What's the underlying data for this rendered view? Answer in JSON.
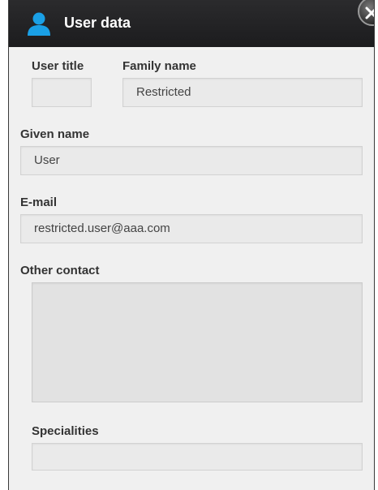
{
  "dialog": {
    "title": "User data",
    "close_icon": "close-icon",
    "title_icon": "user-icon",
    "accent_color": "#1aa0e6"
  },
  "fields": {
    "user_title": {
      "label": "User title",
      "value": ""
    },
    "family_name": {
      "label": "Family name",
      "value": "Restricted"
    },
    "given_name": {
      "label": "Given name",
      "value": "User"
    },
    "email": {
      "label": "E-mail",
      "value": "restricted.user@aaa.com"
    },
    "other_contact": {
      "label": "Other contact",
      "value": ""
    },
    "specialities": {
      "label": "Specialities",
      "value": ""
    }
  }
}
